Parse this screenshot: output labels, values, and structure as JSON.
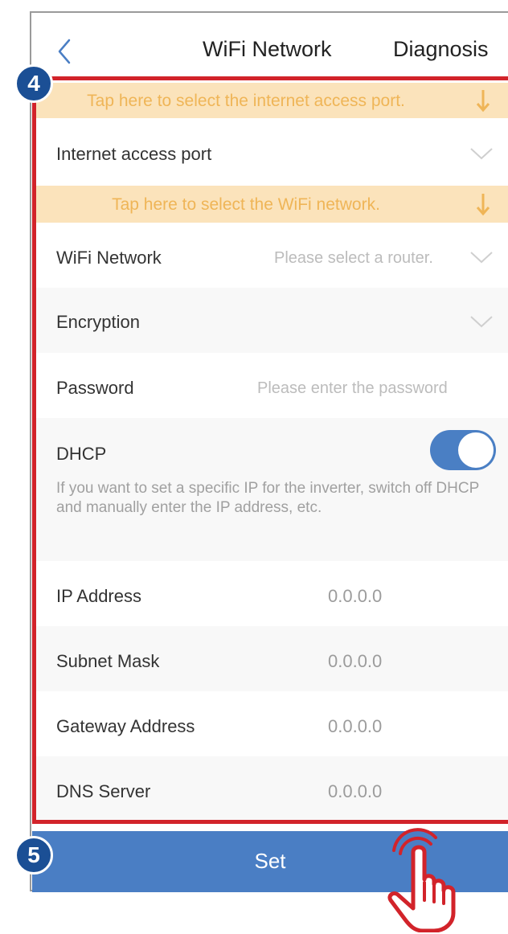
{
  "header": {
    "title": "WiFi Network",
    "right_action": "Diagnosis"
  },
  "tips": {
    "port_tip": "Tap here to select the internet access port.",
    "wifi_tip": "Tap here to select the WiFi network."
  },
  "form": {
    "internet_port": {
      "label": "Internet access port",
      "value": ""
    },
    "wifi_network": {
      "label": "WiFi Network",
      "placeholder": "Please select a router."
    },
    "encryption": {
      "label": "Encryption",
      "value": ""
    },
    "password": {
      "label": "Password",
      "placeholder": "Please enter the password"
    },
    "dhcp": {
      "label": "DHCP",
      "enabled": true,
      "description": "If you want to set a specific IP for the inverter, switch off DHCP and manually enter the IP address, etc."
    },
    "ip_address": {
      "label": "IP Address",
      "value": "0.0.0.0"
    },
    "subnet_mask": {
      "label": "Subnet Mask",
      "value": "0.0.0.0"
    },
    "gateway": {
      "label": "Gateway Address",
      "value": "0.0.0.0"
    },
    "dns": {
      "label": "DNS Server",
      "value": "0.0.0.0"
    }
  },
  "set_button": {
    "label": "Set"
  },
  "annotations": {
    "step4": "4",
    "step5": "5"
  },
  "colors": {
    "accent": "#4a7ec4",
    "highlight": "#d2232a",
    "tip_bg": "#fbe3bb",
    "tip_text": "#efb557",
    "badge": "#1b4f95"
  },
  "icons": {
    "back": "chevron-left-icon",
    "dropdown": "chevron-down-icon",
    "tip_arrow": "arrow-down-icon",
    "hand": "tap-hand-icon"
  }
}
